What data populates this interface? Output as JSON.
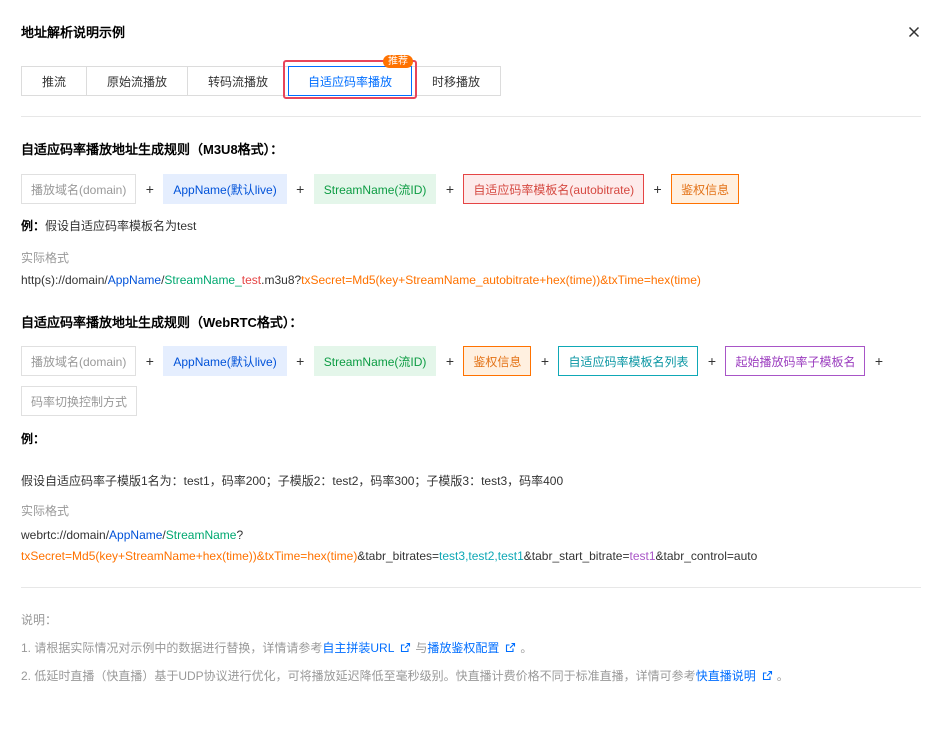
{
  "dialog": {
    "title": "地址解析说明示例",
    "close_icon": "close-icon"
  },
  "tabs": [
    {
      "label": "推流",
      "active": false
    },
    {
      "label": "原始流播放",
      "active": false
    },
    {
      "label": "转码流播放",
      "active": false
    },
    {
      "label": "自适应码率播放",
      "active": true,
      "badge": "推荐"
    },
    {
      "label": "时移播放",
      "active": false
    }
  ],
  "m3u8": {
    "title": "自适应码率播放地址生成规则（M3U8格式）：",
    "chips": {
      "domain": "播放域名(domain)",
      "appname": "AppName(默认live)",
      "streamname": "StreamName(流ID)",
      "template": "自适应码率模板名(autobitrate)",
      "auth": "鉴权信息"
    },
    "plus": "+",
    "example_label": "例：",
    "example_text": "假设自适应码率模板名为test",
    "format_caption": "实际格式",
    "url": {
      "p1": "http(s)://domain/",
      "p2": "AppName",
      "p3": "/",
      "p4": "StreamName",
      "p5": "_",
      "p6": "test",
      "p7": ".m3u8?",
      "p8": "txSecret=Md5(key+StreamName_autobitrate+hex(time))&txTime=hex(time)"
    }
  },
  "webrtc": {
    "title": "自适应码率播放地址生成规则（WebRTC格式）：",
    "chips": {
      "domain": "播放域名(domain)",
      "appname": "AppName(默认live)",
      "streamname": "StreamName(流ID)",
      "auth": "鉴权信息",
      "template_list": "自适应码率模板名列表",
      "start_template": "起始播放码率子模板名",
      "switch_mode": "码率切换控制方式"
    },
    "plus": "+",
    "example_label": "例：",
    "example_text": "假设自适应码率子模版1名为：test1，码率200；子模版2：test2，码率300；子模版3：test3，码率400",
    "format_caption": "实际格式",
    "url_line1": {
      "p1": "webrtc://domain/",
      "p2": "AppName",
      "p3": "/",
      "p4": "StreamName",
      "p5": "?"
    },
    "url_line2": {
      "p1": "txSecret=Md5(key+StreamName+hex(time))&txTime=hex(time)",
      "p2": "&tabr_bitrates=",
      "p3": "test3,test2,test1",
      "p4": "&tabr_start_bitrate=",
      "p5": "test1",
      "p6": "&tabr_control=auto"
    }
  },
  "notes": {
    "heading": "说明：",
    "n1_prefix": "1. 请根据实际情况对示例中的数据进行替换，详情请参考",
    "n1_link1": "自主拼装URL",
    "n1_mid": "与",
    "n1_link2": "播放鉴权配置",
    "n1_suffix": "。",
    "n2_prefix": "2. 低延时直播（快直播）基于UDP协议进行优化，可将播放延迟降低至毫秒级别。快直播计费价格不同于标准直播，详情可参考",
    "n2_link": "快直播说明",
    "n2_suffix": "。",
    "link_icon": "external-link-icon"
  },
  "colors": {
    "link": "#006eff",
    "tab_active": "#006eff",
    "tab_highlight": "#e8455a",
    "badge": "#ff7200"
  }
}
